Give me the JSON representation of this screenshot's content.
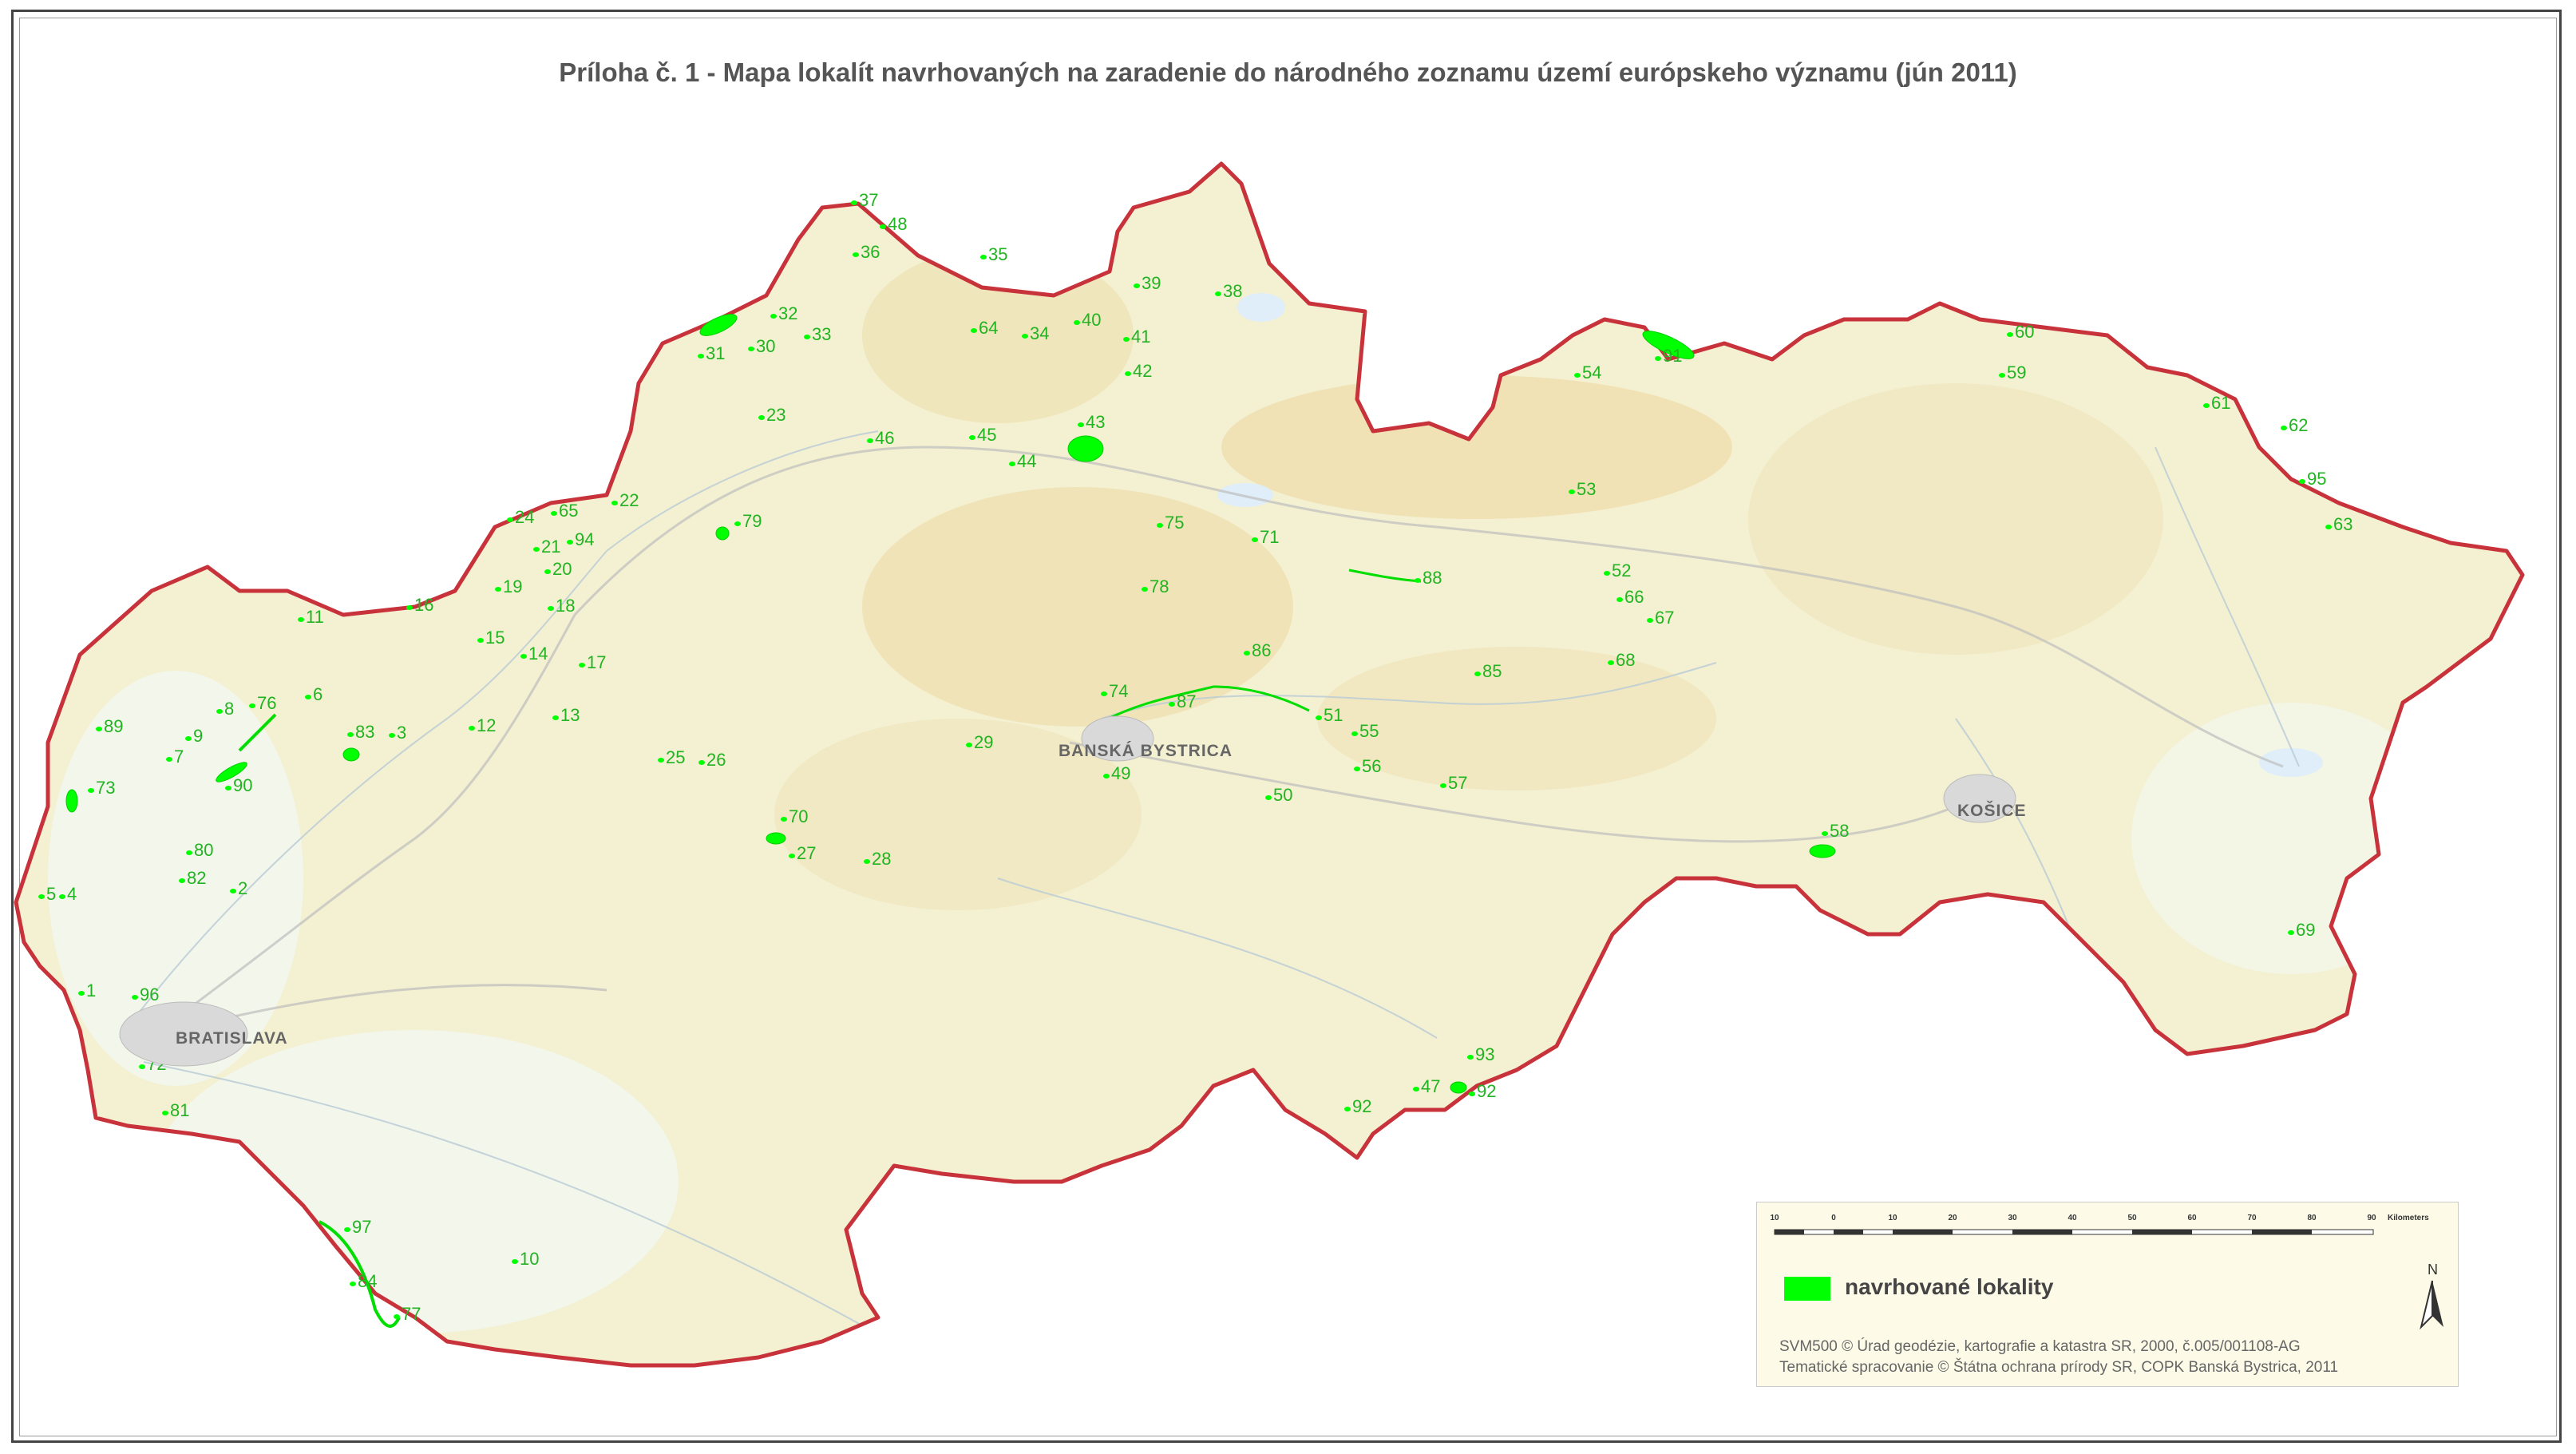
{
  "title": "Príloha č. 1 - Mapa lokalít navrhovaných na zaradenie do národného zoznamu území európskeho významu (jún 2011)",
  "cities": [
    {
      "name": "BRATISLAVA"
    },
    {
      "name": "BANSKÁ BYSTRICA"
    },
    {
      "name": "KOŠICE"
    }
  ],
  "sites": [
    "37",
    "48",
    "36",
    "35",
    "39",
    "38",
    "32",
    "33",
    "31",
    "30",
    "64",
    "34",
    "40",
    "41",
    "42",
    "60",
    "59",
    "91",
    "54",
    "23",
    "46",
    "45",
    "43",
    "44",
    "61",
    "62",
    "22",
    "24",
    "65",
    "79",
    "94",
    "53",
    "95",
    "63",
    "21",
    "20",
    "75",
    "71",
    "19",
    "18",
    "16",
    "11",
    "88",
    "52",
    "66",
    "67",
    "78",
    "15",
    "14",
    "17",
    "86",
    "68",
    "85",
    "89",
    "6",
    "8",
    "76",
    "74",
    "87",
    "13",
    "12",
    "9",
    "7",
    "83",
    "3",
    "51",
    "55",
    "29",
    "49",
    "56",
    "57",
    "73",
    "90",
    "25",
    "26",
    "50",
    "70",
    "27",
    "80",
    "28",
    "58",
    "82",
    "2",
    "5",
    "4",
    "1",
    "96",
    "69",
    "72",
    "93",
    "47",
    "92",
    "92",
    "81",
    "97",
    "10",
    "84",
    "77"
  ],
  "legend": {
    "scale_ticks": [
      "10",
      "0",
      "10",
      "20",
      "30",
      "40",
      "50",
      "60",
      "70",
      "80",
      "90"
    ],
    "scale_unit": "Kilometers",
    "symbol_label": "navrhované lokality",
    "symbol_color": "#00ff00",
    "north": "N",
    "credit_line1": "SVM500 © Úrad geodézie, kartografie a katastra SR, 2000, č.005/001108-AG",
    "credit_line2": "Tematické spracovanie © Štátna ochrana prírody SR, COPK Banská Bystrica, 2011"
  },
  "colors": {
    "border": "#c8323a",
    "land": "#f4f0d2",
    "highland": "#ecd9a2",
    "lowland": "#f2f6ec",
    "sites": "#00ff00",
    "labels": "#22b322"
  }
}
